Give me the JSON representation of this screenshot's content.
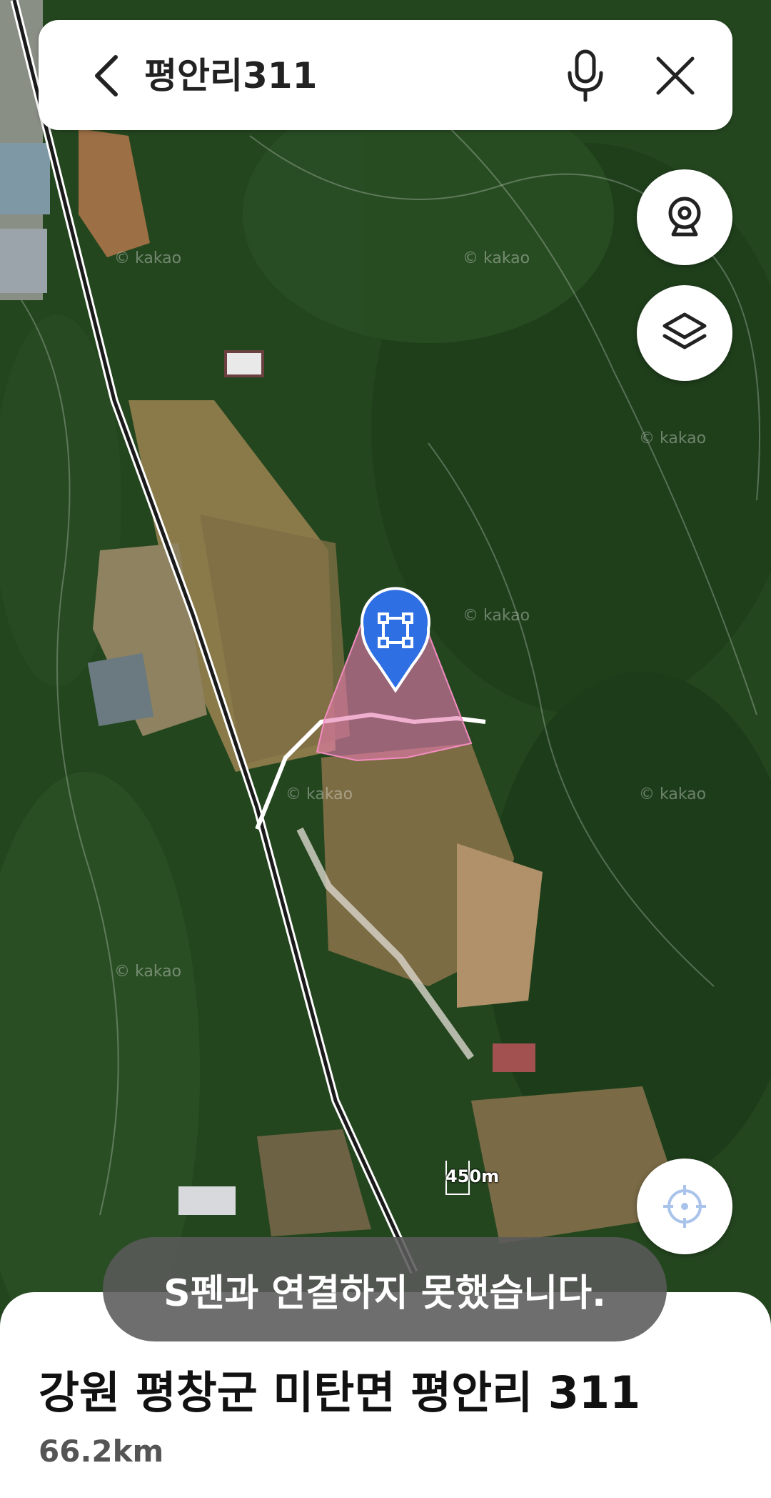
{
  "search": {
    "query": "평안리311"
  },
  "map": {
    "watermark": "© kakao",
    "scale_label": "450m",
    "parcel_color": "#e879b0",
    "marker_color": "#2f6fe4"
  },
  "controls": {
    "roadview_icon": "roadview-camera-icon",
    "layers_icon": "layers-icon",
    "locate_icon": "current-location-icon"
  },
  "toast": {
    "message": "S펜과 연결하지 못했습니다."
  },
  "place": {
    "address": "강원 평창군 미탄면 평안리 311",
    "distance": "66.2km"
  }
}
